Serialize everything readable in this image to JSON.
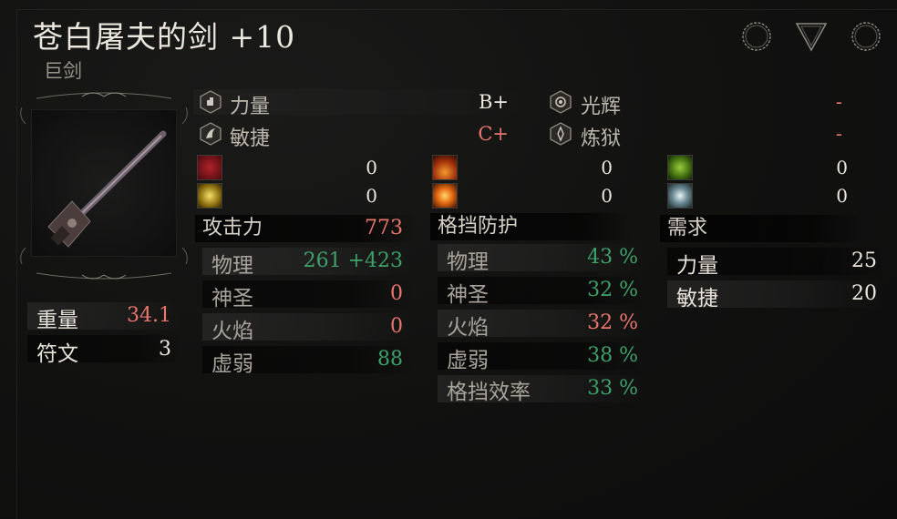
{
  "weapon": {
    "name": "苍白屠夫的剑 +10",
    "category": "巨剑",
    "weight_label": "重量",
    "weight_value": "34.1",
    "rune_label": "符文",
    "rune_value": "3"
  },
  "top_icons": [
    "ring-slot-icon",
    "triangle-slot-icon",
    "ring-slot-icon"
  ],
  "scaling": [
    {
      "label": "力量",
      "grade": "B+",
      "icon": "strength-icon"
    },
    {
      "label": "敏捷",
      "grade": "C+",
      "icon": "dexterity-icon"
    },
    {
      "label": "光辉",
      "grade": "-",
      "icon": "radiance-icon"
    },
    {
      "label": "炼狱",
      "grade": "-",
      "icon": "inferno-icon"
    }
  ],
  "elemental_bonus": [
    {
      "icon": "bleed-icon",
      "value": "0"
    },
    {
      "icon": "holy-light-icon",
      "value": "0"
    },
    {
      "icon": "fire-icon",
      "value": "0"
    },
    {
      "icon": "burn-icon",
      "value": "0"
    },
    {
      "icon": "poison-icon",
      "value": "0"
    },
    {
      "icon": "frost-icon",
      "value": "0"
    }
  ],
  "attack": {
    "header": "攻击力",
    "total": "773",
    "rows": [
      {
        "label": "物理",
        "value": "261 +423"
      },
      {
        "label": "神圣",
        "value": "0"
      },
      {
        "label": "火焰",
        "value": "0"
      },
      {
        "label": "虚弱",
        "value": "88"
      }
    ]
  },
  "guard": {
    "header": "格挡防护",
    "rows": [
      {
        "label": "物理",
        "value": "43 %"
      },
      {
        "label": "神圣",
        "value": "32 %"
      },
      {
        "label": "火焰",
        "value": "32 %"
      },
      {
        "label": "虚弱",
        "value": "38 %"
      },
      {
        "label": "格挡效率",
        "value": "33 %"
      }
    ]
  },
  "requirements": {
    "header": "需求",
    "rows": [
      {
        "label": "力量",
        "value": "25"
      },
      {
        "label": "敏捷",
        "value": "20"
      }
    ]
  },
  "colors": {
    "negative": "#e8766d",
    "positive": "#3fa06a",
    "neutral": "#ece7dd"
  }
}
